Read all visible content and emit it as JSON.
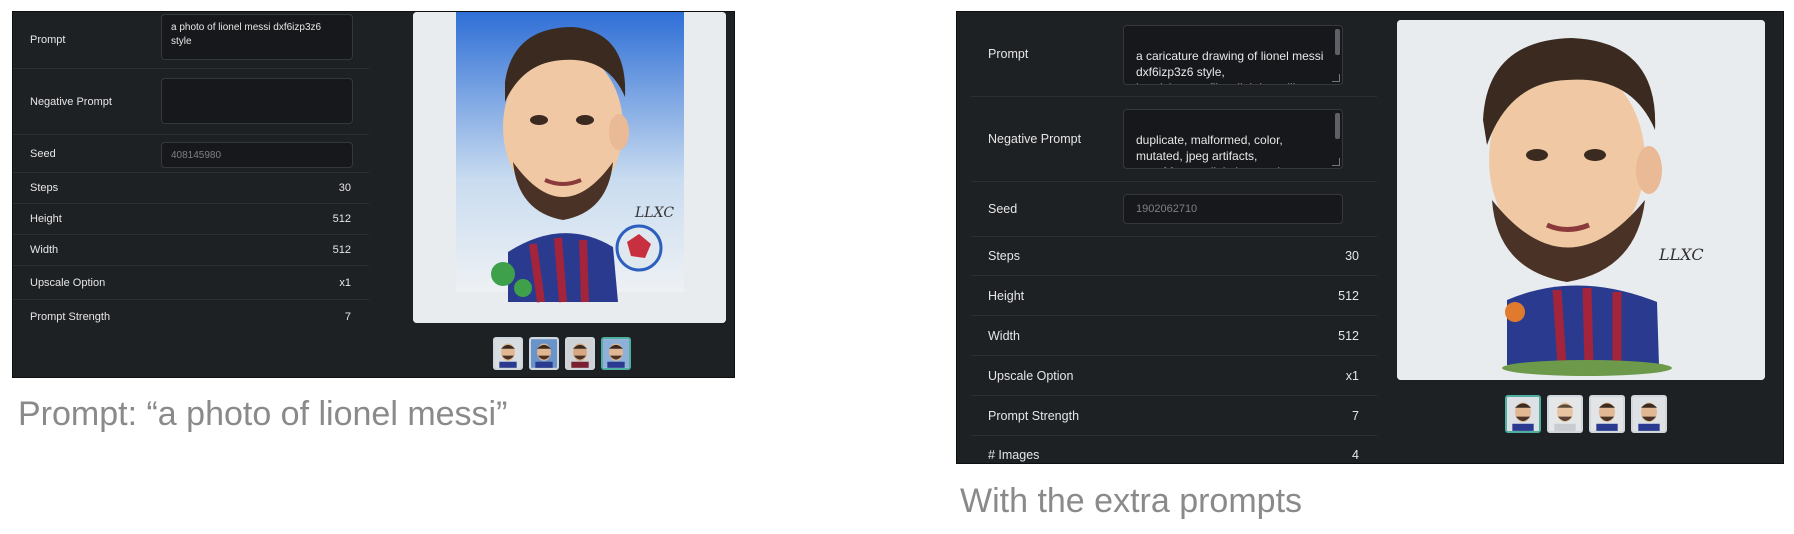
{
  "panel1": {
    "form": {
      "prompt_label": "Prompt",
      "prompt_value": "a photo of lionel messi dxf6izp3z6\nstyle",
      "negative_label": "Negative Prompt",
      "negative_value": "",
      "seed_label": "Seed",
      "seed_placeholder": "408145980",
      "steps_label": "Steps",
      "steps_value": "30",
      "height_label": "Height",
      "height_value": "512",
      "width_label": "Width",
      "width_value": "512",
      "upscale_label": "Upscale Option",
      "upscale_value": "x1",
      "strength_label": "Prompt Strength",
      "strength_value": "7"
    },
    "art_signature": "LLXC",
    "caption": "Prompt: “a photo of lionel messi”"
  },
  "panel2": {
    "form": {
      "prompt_label": "Prompt",
      "prompt_value": "a caricature drawing of lionel messi\ndxf6izp3z6 style,\nheadshot, profile, slightly smiling,",
      "negative_label": "Negative Prompt",
      "negative_value": "duplicate, malformed, color,\nmutated, jpeg artifacts,\nout of frame, digital, smooth",
      "seed_label": "Seed",
      "seed_placeholder": "1902062710",
      "steps_label": "Steps",
      "steps_value": "30",
      "height_label": "Height",
      "height_value": "512",
      "width_label": "Width",
      "width_value": "512",
      "upscale_label": "Upscale Option",
      "upscale_value": "x1",
      "strength_label": "Prompt Strength",
      "strength_value": "7",
      "images_label": "# Images",
      "images_value": "4"
    },
    "art_signature": "LLXC",
    "caption": "With the extra prompts"
  },
  "colors": {
    "panel_bg": "#1e2124",
    "accent": "#4fb0a2",
    "caption": "#8a8a8a"
  }
}
